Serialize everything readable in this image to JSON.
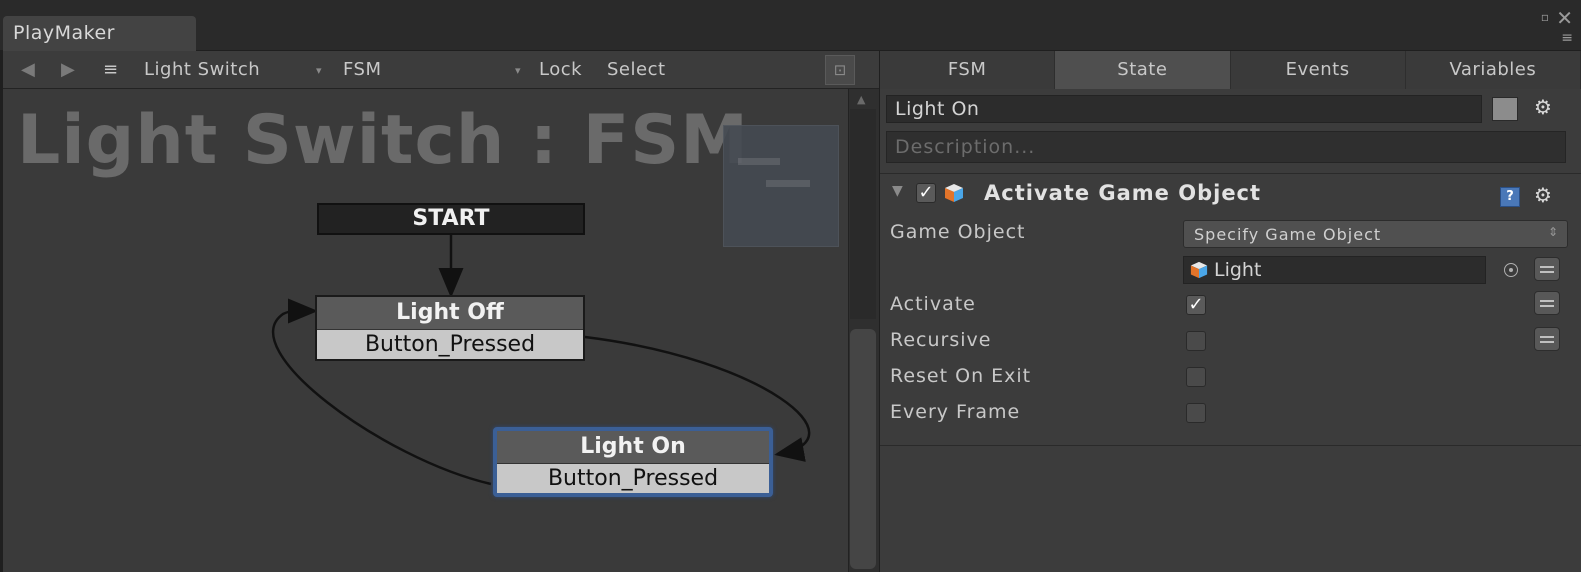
{
  "window": {
    "tab_title": "PlayMaker",
    "restore_icon": "restore-icon",
    "close_icon": "close-icon",
    "menu_icon": "menu-icon"
  },
  "toolbar": {
    "back_icon": "◀",
    "forward_icon": "▶",
    "list_icon": "≡",
    "gameobject": "Light Switch",
    "fsm": "FSM",
    "lock": "Lock",
    "select": "Select",
    "dropdown_arrow": "▾",
    "grid_icon": "⊡"
  },
  "inspector_tabs": [
    {
      "label": "FSM",
      "active": false
    },
    {
      "label": "State",
      "active": true
    },
    {
      "label": "Events",
      "active": false
    },
    {
      "label": "Variables",
      "active": false
    }
  ],
  "graph": {
    "title": "Light Switch : FSM",
    "start_label": "START",
    "states": [
      {
        "name": "Light Off",
        "transition": "Button_Pressed",
        "selected": false
      },
      {
        "name": "Light On",
        "transition": "Button_Pressed",
        "selected": true
      }
    ]
  },
  "state_inspector": {
    "state_name": "Light On",
    "description_placeholder": "Description...",
    "state_color": "#8c8c8c",
    "action": {
      "enabled": true,
      "title": "Activate Game Object",
      "help_icon": "?",
      "properties": {
        "game_object_label": "Game Object",
        "game_object_mode": "Specify Game Object",
        "game_object_value": "Light",
        "activate_label": "Activate",
        "activate": true,
        "recursive_label": "Recursive",
        "recursive": false,
        "reset_on_exit_label": "Reset On Exit",
        "reset_on_exit": false,
        "every_frame_label": "Every Frame",
        "every_frame": false
      }
    }
  },
  "colors": {
    "selected_border": "#3b5f96",
    "graph_bg": "#3a3a3a",
    "panel_bg": "#3c3c3c"
  }
}
